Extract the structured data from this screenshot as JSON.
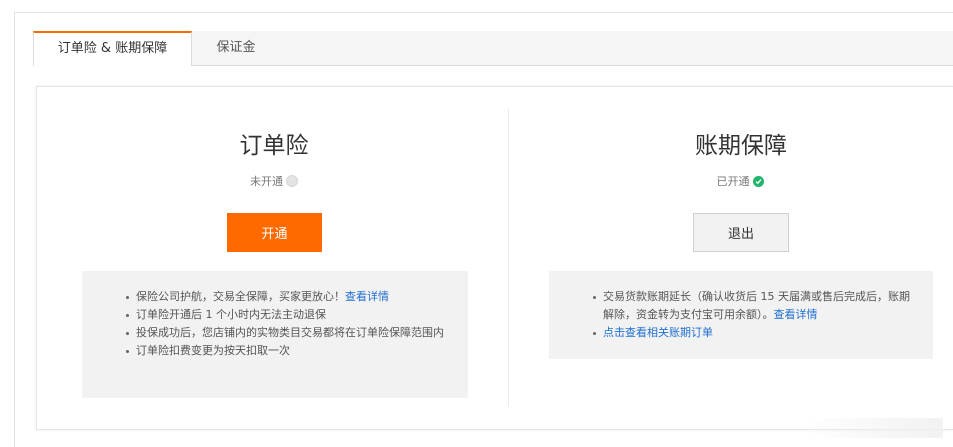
{
  "tabs": [
    {
      "label": "订单险 & 账期保障",
      "active": true
    },
    {
      "label": "保证金",
      "active": false
    }
  ],
  "cards": {
    "insurance": {
      "title": "订单险",
      "status": "未开通",
      "button": "开通",
      "bullets": [
        {
          "text": "保险公司护航，交易全保障，买家更放心！",
          "link": "查看详情"
        },
        {
          "text": "订单险开通后 1 个小时内无法主动退保"
        },
        {
          "text": "投保成功后，您店铺内的实物类目交易都将在订单险保障范围内"
        },
        {
          "text": "订单险扣费变更为按天扣取一次"
        }
      ]
    },
    "credit": {
      "title": "账期保障",
      "status": "已开通",
      "button": "退出",
      "bullets": [
        {
          "text": "交易货款账期延长（确认收货后 15 天届满或售后完成后，账期解除，资金转为支付宝可用余额）。",
          "link": "查看详情"
        },
        {
          "text": "",
          "link": "点击查看相关账期订单"
        }
      ]
    }
  },
  "colors": {
    "accent": "#ff6a00",
    "link": "#1f6fd1",
    "success": "#1fb469"
  }
}
